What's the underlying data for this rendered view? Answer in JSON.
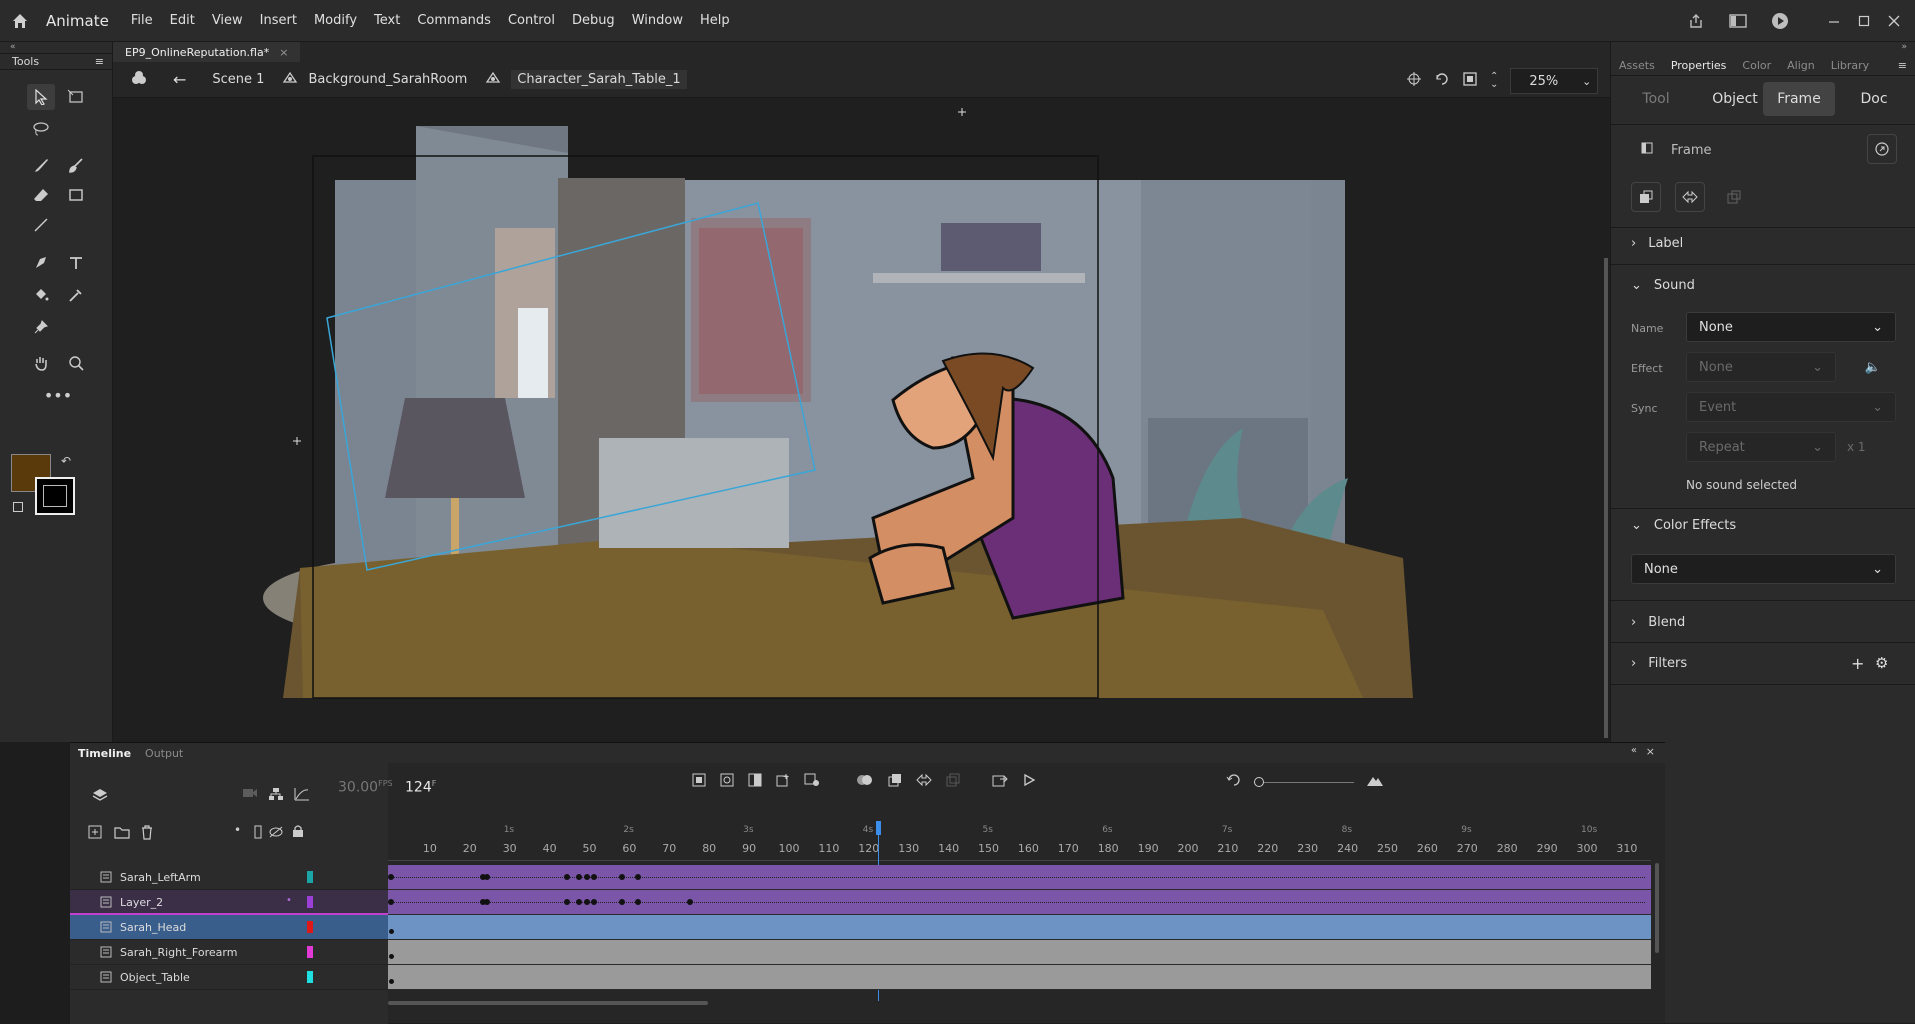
{
  "app": {
    "name": "Animate",
    "menus": [
      "File",
      "Edit",
      "View",
      "Insert",
      "Modify",
      "Text",
      "Commands",
      "Control",
      "Debug",
      "Window",
      "Help"
    ]
  },
  "tools_panel": {
    "title": "Tools"
  },
  "document": {
    "tab_title": "EP9_OnlineReputation.fla*"
  },
  "editbar": {
    "scene": "Scene 1",
    "symbol1": "Background_SarahRoom",
    "symbol2": "Character_Sarah_Table_1",
    "zoom": "25%"
  },
  "properties": {
    "top_tabs": [
      "Assets",
      "Properties",
      "Color",
      "Align",
      "Library"
    ],
    "active_top_tab": "Properties",
    "segments": [
      "Tool",
      "Object",
      "Frame",
      "Doc"
    ],
    "active_segment": "Frame",
    "frame_header": "Frame",
    "sections": {
      "label": "Label",
      "sound": "Sound",
      "color_effects": "Color Effects",
      "blend": "Blend",
      "filters": "Filters"
    },
    "sound": {
      "name_label": "Name",
      "name_value": "None",
      "effect_label": "Effect",
      "effect_value": "None",
      "sync_label": "Sync",
      "sync_value": "Event",
      "repeat_value": "Repeat",
      "repeat_count": "x 1",
      "status": "No sound selected"
    },
    "color_effect_value": "None"
  },
  "timeline": {
    "tabs": [
      "Timeline",
      "Output"
    ],
    "fps": "30.00",
    "fps_unit": "FPS",
    "current_frame": "124",
    "frame_unit": "F",
    "ruler_labels": [
      "10",
      "20",
      "30",
      "40",
      "50",
      "60",
      "70",
      "80",
      "90",
      "100",
      "110",
      "120",
      "130",
      "140",
      "150",
      "160",
      "170",
      "180",
      "190",
      "200",
      "210",
      "220",
      "230",
      "240",
      "250",
      "260",
      "270",
      "280",
      "290",
      "300",
      "310"
    ],
    "second_labels": [
      "1s",
      "2s",
      "3s",
      "4s",
      "5s",
      "6s",
      "7s",
      "8s",
      "9s",
      "10s"
    ],
    "layers": [
      {
        "name": "Sarah_LeftArm",
        "color": "#1aa6a6"
      },
      {
        "name": "Layer_2",
        "color": "#9b3fd6"
      },
      {
        "name": "Sarah_Head",
        "color": "#e01818"
      },
      {
        "name": "Sarah_Right_Forearm",
        "color": "#e23ad6"
      },
      {
        "name": "Object_Table",
        "color": "#1ee0e0"
      }
    ]
  },
  "colors": {
    "fill_swatch": "#5a3a0a",
    "accent_blue": "#3a5e8c",
    "purple_frames": "#7a55a8",
    "playhead": "#3b8eea"
  }
}
